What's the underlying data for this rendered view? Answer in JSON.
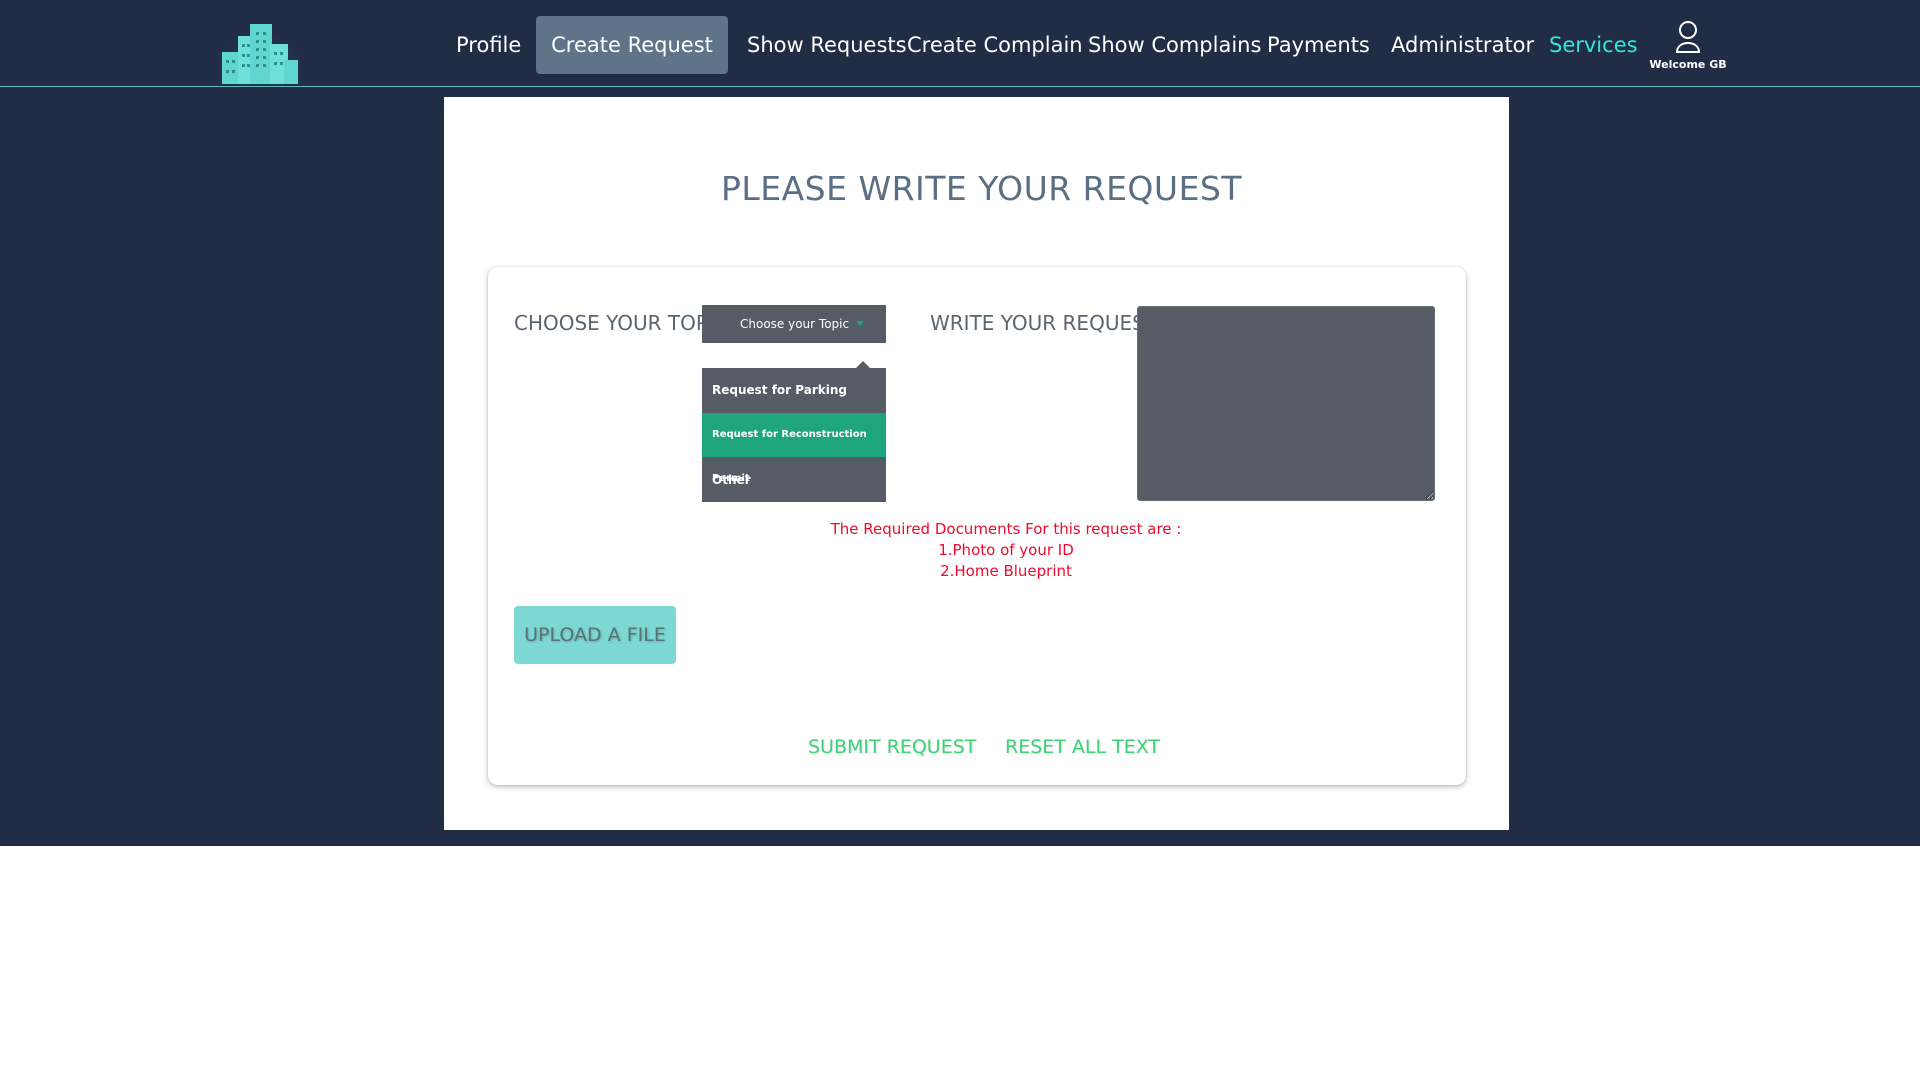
{
  "nav": {
    "profile": "Profile",
    "create_request": "Create Request",
    "show_requests": "Show Requests",
    "create_complain": "Create Complain",
    "show_complains": "Show Complains",
    "payments": "Payments",
    "administrator": "Administrator",
    "services": "Services",
    "user_icon": "user-icon",
    "welcome": "Welcome GB"
  },
  "logo": {
    "icon": "building-logo"
  },
  "page": {
    "title": "PLEASE WRITE YOUR REQUEST"
  },
  "form": {
    "topic_label": "CHOOSE YOUR TOPIC :",
    "topic_placeholder": "Choose your Topic",
    "topic_options": [
      "Request for Parking",
      "Request for Reconstruction Permit",
      "Other"
    ],
    "selected_option_index": 1,
    "request_label": "WRITE YOUR REQUEST :",
    "request_value": "",
    "docs_heading": "The Required Documents For this request are :",
    "docs_items": [
      "1.Photo of your ID",
      "2.Home Blueprint"
    ],
    "upload_label": "UPLOAD A FILE",
    "submit_label": "SUBMIT REQUEST",
    "reset_label": "RESET ALL TEXT"
  },
  "colors": {
    "background": "#212d45",
    "nav_active": "#5f7488",
    "accent": "#2ee8de",
    "selected_option": "#1fa57c",
    "docs_text": "#ec0c2e",
    "action_text": "#3dd17a",
    "upload_bg": "#7dd8d4"
  }
}
